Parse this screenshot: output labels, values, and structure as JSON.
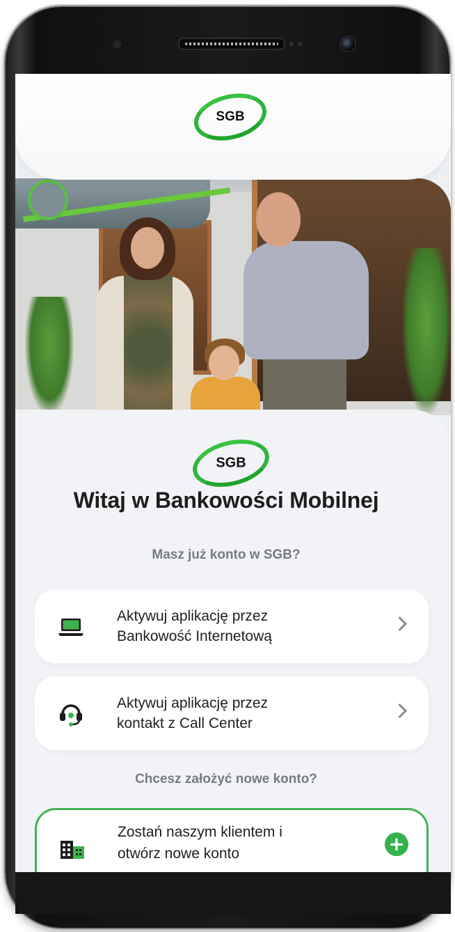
{
  "brand": {
    "logo_text": "SGB",
    "accent_color": "#35b14b"
  },
  "welcome": {
    "title": "Witaj w Bankowości Mobilnej"
  },
  "existing_account": {
    "label": "Masz już konto w SGB?",
    "options": [
      {
        "line1": "Aktywuj aplikację przez",
        "line2": "Bankowość Internetową",
        "icon": "laptop-icon"
      },
      {
        "line1": "Aktywuj aplikację przez",
        "line2": "kontakt z Call Center",
        "icon": "headset-icon"
      }
    ]
  },
  "new_account": {
    "label": "Chcesz założyć nowe konto?",
    "line1": "Zostań naszym klientem i",
    "line2": "otwórz nowe konto",
    "icon": "building-icon",
    "action_icon": "plus-icon"
  }
}
